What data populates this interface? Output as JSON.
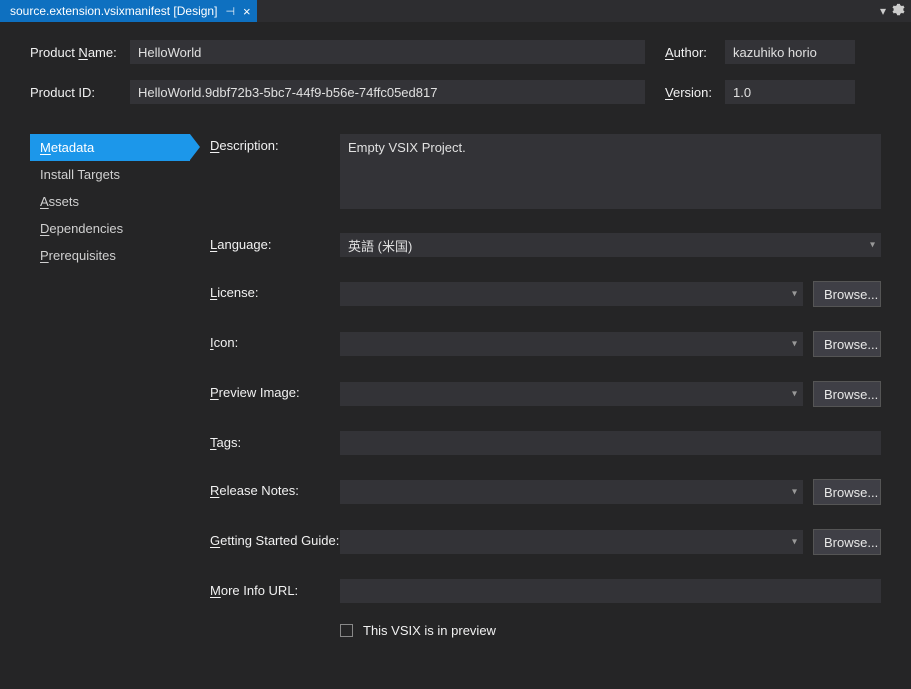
{
  "tab": {
    "title": "source.extension.vsixmanifest [Design]"
  },
  "header": {
    "product_name_label_pre": "Product ",
    "product_name_label_u": "N",
    "product_name_label_post": "ame:",
    "product_name_value": "HelloWorld",
    "author_label_u": "A",
    "author_label_post": "uthor:",
    "author_value": "kazuhiko horio",
    "product_id_label": "Product ID:",
    "product_id_value": "HelloWorld.9dbf72b3-5bc7-44f9-b56e-74ffc05ed817",
    "version_label_u": "V",
    "version_label_post": "ersion:",
    "version_value": "1.0"
  },
  "sidebar": {
    "items": [
      {
        "u": "M",
        "rest": "etadata",
        "active": true
      },
      {
        "u": "",
        "rest": "Install Targets",
        "active": false
      },
      {
        "u": "A",
        "rest": "ssets",
        "active": false
      },
      {
        "u": "D",
        "rest": "ependencies",
        "active": false
      },
      {
        "u": "P",
        "rest": "rerequisites",
        "active": false
      }
    ]
  },
  "form": {
    "description_label_u": "D",
    "description_label_post": "escription:",
    "description_value": "Empty VSIX Project.",
    "language_label_u": "L",
    "language_label_post": "anguage:",
    "language_value": "英語 (米国)",
    "license_label_u": "L",
    "license_label_post": "icense:",
    "license_value": "",
    "icon_label_u": "I",
    "icon_label_post": "con:",
    "icon_value": "",
    "preview_label_u": "P",
    "preview_label_post": "review Image:",
    "preview_value": "",
    "tags_label_u": "T",
    "tags_label_post": "ags:",
    "tags_value": "",
    "release_label_u": "R",
    "release_label_post": "elease Notes:",
    "release_value": "",
    "guide_label_u": "G",
    "guide_label_post": "etting Started Guide:",
    "guide_value": "",
    "moreinfo_label_u": "M",
    "moreinfo_label_post": "ore Info URL:",
    "moreinfo_value": "",
    "browse_label": "Browse...",
    "preview_checkbox_label": "This VSIX is in preview"
  }
}
